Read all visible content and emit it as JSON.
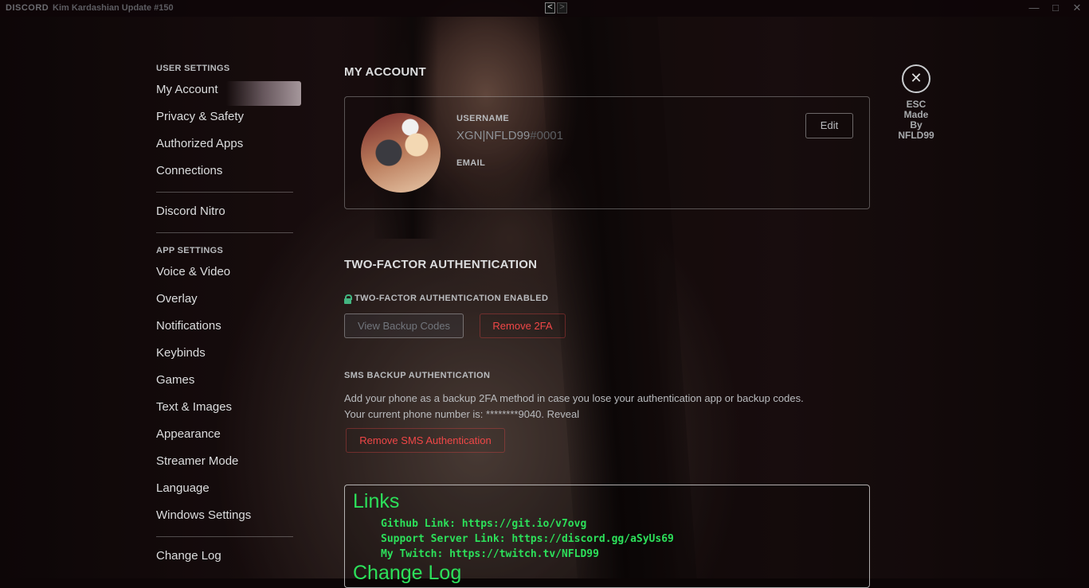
{
  "titlebar": {
    "logo": "DISCORD",
    "title": "Kim Kardashian Update #150",
    "back_glyph": "<",
    "forward_glyph": ">"
  },
  "sidebar": {
    "user_settings_header": "USER SETTINGS",
    "user_items": [
      {
        "label": "My Account"
      },
      {
        "label": "Privacy & Safety"
      },
      {
        "label": "Authorized Apps"
      },
      {
        "label": "Connections"
      }
    ],
    "nitro_label": "Discord Nitro",
    "app_settings_header": "APP SETTINGS",
    "app_items": [
      {
        "label": "Voice & Video"
      },
      {
        "label": "Overlay"
      },
      {
        "label": "Notifications"
      },
      {
        "label": "Keybinds"
      },
      {
        "label": "Games"
      },
      {
        "label": "Text & Images"
      },
      {
        "label": "Appearance"
      },
      {
        "label": "Streamer Mode"
      },
      {
        "label": "Language"
      },
      {
        "label": "Windows Settings"
      }
    ],
    "change_log_label": "Change Log"
  },
  "account": {
    "title": "MY ACCOUNT",
    "username_label": "USERNAME",
    "username": "XGN|NFLD99",
    "discriminator": "#0001",
    "email_label": "EMAIL",
    "edit_label": "Edit"
  },
  "twofa": {
    "title": "TWO-FACTOR AUTHENTICATION",
    "enabled_label": "TWO-FACTOR AUTHENTICATION ENABLED",
    "view_codes_label": "View Backup Codes",
    "remove_label": "Remove 2FA"
  },
  "sms": {
    "title": "SMS BACKUP AUTHENTICATION",
    "desc_line1": "Add your phone as a backup 2FA method in case you lose your authentication app or backup codes.",
    "desc_line2": "Your current phone number is: ********9040.",
    "reveal_label": "Reveal",
    "remove_label": "Remove SMS Authentication"
  },
  "links": {
    "heading": "Links",
    "github": "Github Link: https://git.io/v7ovg",
    "support": "Support Server Link: https://discord.gg/aSyUs69",
    "twitch": "My Twitch: https://twitch.tv/NFLD99",
    "change_log_heading": "Change Log"
  },
  "close": {
    "glyph": "✕",
    "esc_label": "ESC",
    "made_by_line1": "Made",
    "made_by_line2": "By",
    "made_by_line3": "NFLD99"
  },
  "colors": {
    "accent_green": "#2ce05a",
    "danger_red": "#f04747",
    "lock_green": "#43b581"
  }
}
